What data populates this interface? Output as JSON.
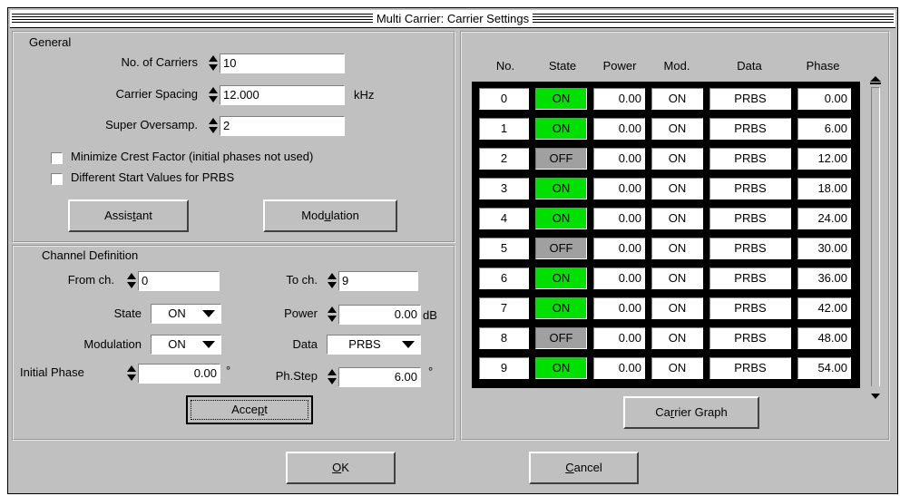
{
  "window": {
    "title": "Multi Carrier: Carrier Settings"
  },
  "general": {
    "legend": "General",
    "carriers_label": "No. of Carriers",
    "carriers_value": "10",
    "spacing_label": "Carrier Spacing",
    "spacing_value": "12.000",
    "spacing_unit": "kHz",
    "oversamp_label": "Super Oversamp.",
    "oversamp_value": "2",
    "crest_label": "Minimize Crest Factor (initial phases not used)",
    "prbs_label": "Different Start Values for PRBS",
    "assistant_pre": "Assis",
    "assistant_u": "t",
    "assistant_post": "ant",
    "modulation_pre": "Mod",
    "modulation_u": "u",
    "modulation_post": "lation"
  },
  "channel": {
    "legend": "Channel Definition",
    "from_label": "From ch.",
    "from_value": "0",
    "to_label": "To ch.",
    "to_value": "9",
    "state_label": "State",
    "state_value": "ON",
    "power_label": "Power",
    "power_value": "0.00",
    "power_unit": "dB",
    "modulation_label": "Modulation",
    "modulation_value": "ON",
    "data_label": "Data",
    "data_value": "PRBS",
    "phase_label": "Initial Phase",
    "phase_value": "0.00",
    "phase_unit": "°",
    "phstep_label": "Ph.Step",
    "phstep_value": "6.00",
    "phstep_unit": "°",
    "accept_pre": "Acce",
    "accept_u": "p",
    "accept_post": "t"
  },
  "table": {
    "headers": [
      "No.",
      "State",
      "Power",
      "Mod.",
      "Data",
      "Phase"
    ],
    "rows": [
      {
        "no": "0",
        "state": "ON",
        "power": "0.00",
        "mod": "ON",
        "data": "PRBS",
        "phase": "0.00"
      },
      {
        "no": "1",
        "state": "ON",
        "power": "0.00",
        "mod": "ON",
        "data": "PRBS",
        "phase": "6.00"
      },
      {
        "no": "2",
        "state": "OFF",
        "power": "0.00",
        "mod": "ON",
        "data": "PRBS",
        "phase": "12.00"
      },
      {
        "no": "3",
        "state": "ON",
        "power": "0.00",
        "mod": "ON",
        "data": "PRBS",
        "phase": "18.00"
      },
      {
        "no": "4",
        "state": "ON",
        "power": "0.00",
        "mod": "ON",
        "data": "PRBS",
        "phase": "24.00"
      },
      {
        "no": "5",
        "state": "OFF",
        "power": "0.00",
        "mod": "ON",
        "data": "PRBS",
        "phase": "30.00"
      },
      {
        "no": "6",
        "state": "ON",
        "power": "0.00",
        "mod": "ON",
        "data": "PRBS",
        "phase": "36.00"
      },
      {
        "no": "7",
        "state": "ON",
        "power": "0.00",
        "mod": "ON",
        "data": "PRBS",
        "phase": "42.00"
      },
      {
        "no": "8",
        "state": "OFF",
        "power": "0.00",
        "mod": "ON",
        "data": "PRBS",
        "phase": "48.00"
      },
      {
        "no": "9",
        "state": "ON",
        "power": "0.00",
        "mod": "ON",
        "data": "PRBS",
        "phase": "54.00"
      }
    ],
    "graph_pre": "Ca",
    "graph_u": "r",
    "graph_post": "rier Graph"
  },
  "footer": {
    "ok_u": "O",
    "ok_post": "K",
    "cancel_u": "C",
    "cancel_post": "ancel"
  },
  "colors": {
    "on": "#00e000",
    "off": "#a0a0a0",
    "face": "#c0c0c0"
  }
}
